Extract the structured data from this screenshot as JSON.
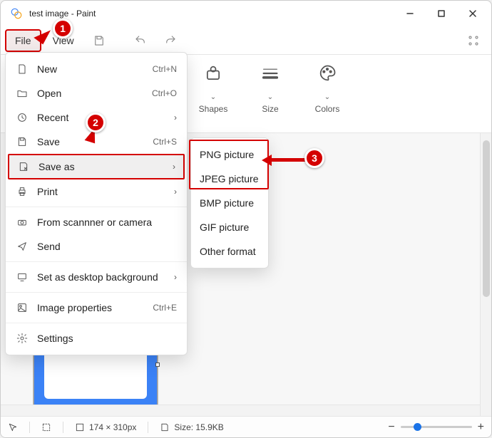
{
  "titlebar": {
    "title": "test image - Paint"
  },
  "menubar": {
    "file": "File",
    "view": "View"
  },
  "ribbon": {
    "shapes": "Shapes",
    "size": "Size",
    "colors": "Colors"
  },
  "file_menu": {
    "new": {
      "label": "New",
      "shortcut": "Ctrl+N"
    },
    "open": {
      "label": "Open",
      "shortcut": "Ctrl+O"
    },
    "recent": {
      "label": "Recent"
    },
    "save": {
      "label": "Save",
      "shortcut": "Ctrl+S"
    },
    "save_as": {
      "label": "Save as"
    },
    "print": {
      "label": "Print"
    },
    "scanner": {
      "label": "From scannner or camera"
    },
    "send": {
      "label": "Send"
    },
    "set_bg": {
      "label": "Set as desktop background"
    },
    "props": {
      "label": "Image properties",
      "shortcut": "Ctrl+E"
    },
    "settings": {
      "label": "Settings"
    }
  },
  "saveas_menu": {
    "png": "PNG picture",
    "jpeg": "JPEG picture",
    "bmp": "BMP picture",
    "gif": "GIF picture",
    "other": "Other format"
  },
  "callouts": {
    "one": "1",
    "two": "2",
    "three": "3"
  },
  "status": {
    "dimensions": "174 × 310px",
    "filesize": "Size: 15.9KB",
    "zoom_minus": "−",
    "zoom_plus": "+"
  }
}
